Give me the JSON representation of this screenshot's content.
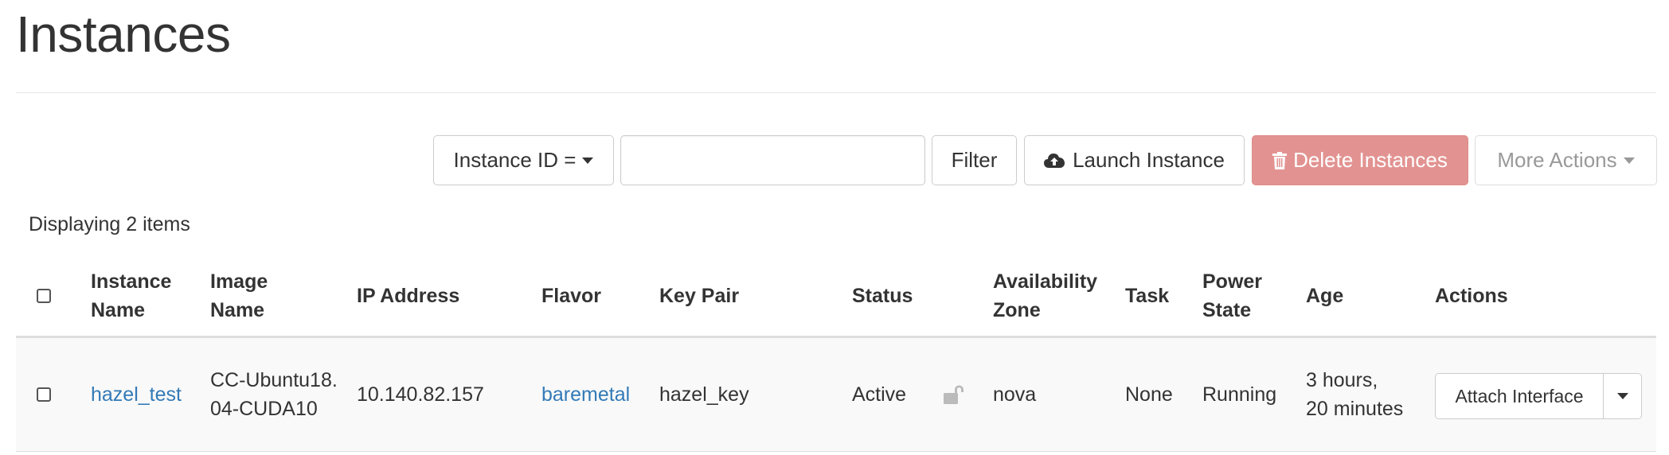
{
  "page": {
    "title": "Instances"
  },
  "toolbar": {
    "filter_field": "Instance ID =",
    "filter_value": "",
    "filter_label": "Filter",
    "launch_label": "Launch Instance",
    "delete_label": "Delete Instances",
    "more_label": "More Actions",
    "icons": [
      "caret-down-icon",
      "cloud-upload-icon",
      "trash-icon"
    ]
  },
  "display_count": "Displaying 2 items",
  "table": {
    "headers": {
      "instance_name": [
        "Instance",
        "Name"
      ],
      "image_name": [
        "Image",
        "Name"
      ],
      "ip_address": "IP Address",
      "flavor": "Flavor",
      "key_pair": "Key Pair",
      "status": "Status",
      "availability_zone": [
        "Availability",
        "Zone"
      ],
      "task": "Task",
      "power_state": [
        "Power",
        "State"
      ],
      "age": "Age",
      "actions": "Actions"
    },
    "rows": [
      {
        "selected": false,
        "instance_name": "hazel_test",
        "image_name": "CC-Ubuntu18.04-CUDA10",
        "ip_address": "10.140.82.157",
        "flavor": "baremetal",
        "key_pair": "hazel_key",
        "status": "Active",
        "lock_icon": "unlock-icon",
        "availability_zone": "nova",
        "task": "None",
        "power_state": "Running",
        "age": [
          "3 hours,",
          "20 minutes"
        ],
        "action_label": "Attach Interface"
      }
    ]
  },
  "colors": {
    "link": "#337ab7",
    "danger_disabled": "#e29391",
    "row_bg": "#f9f9f9",
    "muted": "#999999"
  }
}
